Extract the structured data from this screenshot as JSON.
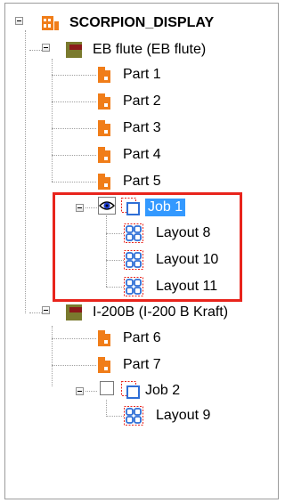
{
  "tree": {
    "root": {
      "label": "SCORPION_DISPLAY",
      "icon": "scorpion-display-icon"
    },
    "boards": [
      {
        "label": "EB flute (EB flute)",
        "icon": "board-icon",
        "parts": [
          "Part 1",
          "Part 2",
          "Part 3",
          "Part 4",
          "Part 5"
        ],
        "jobs": [
          {
            "label": "Job 1",
            "visible": true,
            "selected": true,
            "layouts": [
              "Layout 8",
              "Layout 10",
              "Layout 11"
            ]
          }
        ]
      },
      {
        "label": "I-200B (I-200 B Kraft)",
        "icon": "board-icon",
        "parts": [
          "Part 6",
          "Part 7"
        ],
        "jobs": [
          {
            "label": "Job 2",
            "visible": false,
            "selected": false,
            "layouts": [
              "Layout 9"
            ]
          }
        ]
      }
    ]
  },
  "colors": {
    "accent_orange": "#f07d19",
    "board_green": "#7a7a2e",
    "board_maroon": "#8b1a1a",
    "selection_blue": "#3399ff",
    "highlight_red": "#e8241c",
    "layout_blue": "#2f6fd6"
  }
}
